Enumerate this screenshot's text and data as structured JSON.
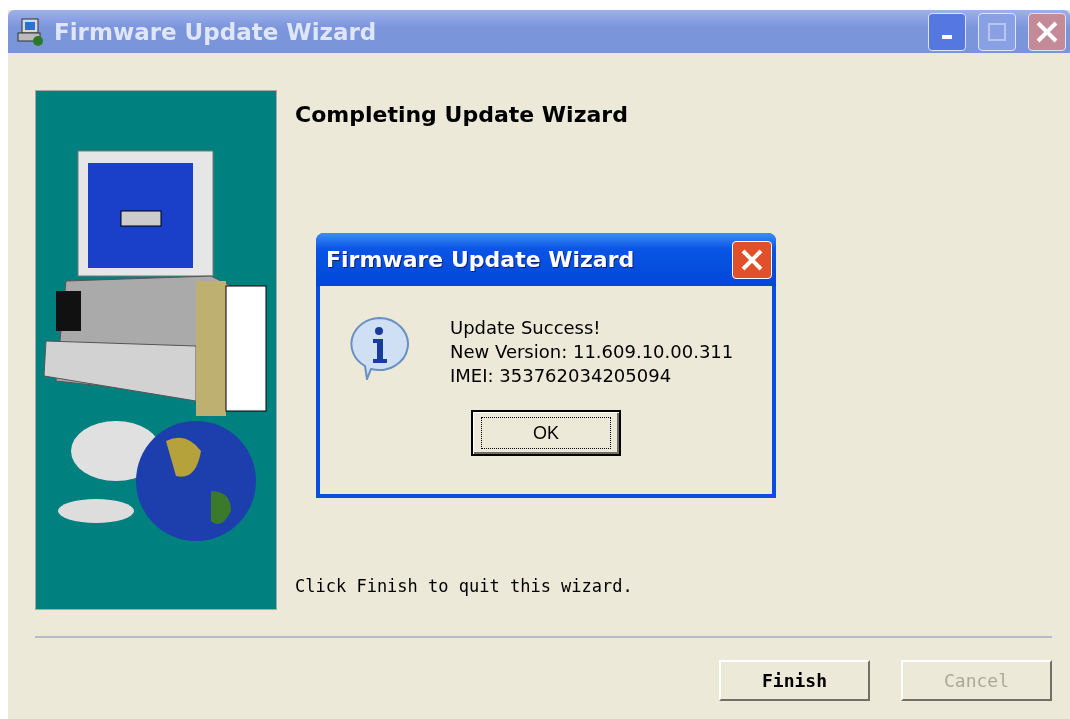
{
  "window": {
    "title": "Firmware Update Wizard"
  },
  "heading": "Completing Update Wizard",
  "instruction": "Click Finish to quit this wizard.",
  "buttons": [
    {
      "label": "Finish",
      "disabled": false
    },
    {
      "label": "Cancel",
      "disabled": true
    }
  ],
  "dialog": {
    "title": "Firmware Update Wizard",
    "lines": [
      "Update Success!",
      "New Version: 11.609.10.00.311",
      "IMEI: 353762034205094"
    ],
    "ok": "OK"
  }
}
